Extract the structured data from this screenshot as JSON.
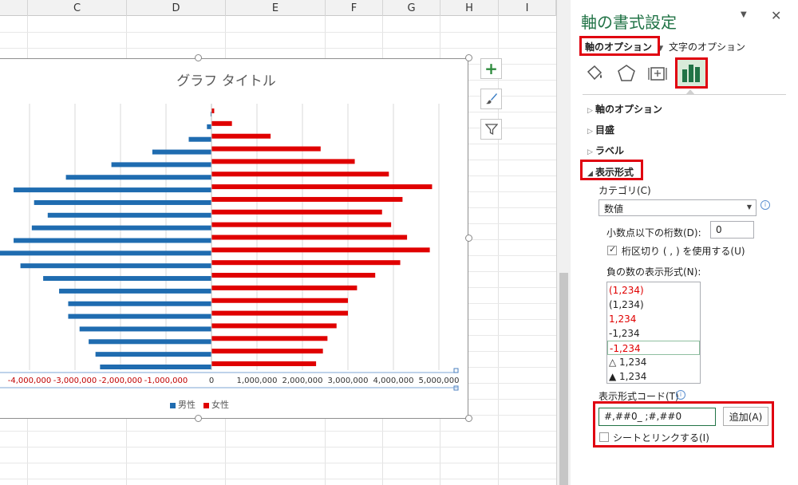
{
  "sheet": {
    "columns": [
      {
        "label": ""
      },
      {
        "label": "C"
      },
      {
        "label": "D"
      },
      {
        "label": "E"
      },
      {
        "label": "F"
      },
      {
        "label": "G"
      },
      {
        "label": "H"
      },
      {
        "label": "I"
      }
    ]
  },
  "chart": {
    "title": "グラフ タイトル",
    "legend": [
      "男性",
      "女性"
    ]
  },
  "chart_data": {
    "type": "bar",
    "orientation": "horizontal",
    "title": "グラフ タイトル",
    "xlim": [
      -5000000,
      5000000
    ],
    "x_ticks": [
      "0",
      "-4,000,000",
      "-3,000,000",
      "-2,000,000",
      "-1,000,000",
      "0",
      "1,000,000",
      "2,000,000",
      "3,000,000",
      "4,000,000",
      "5,000,000"
    ],
    "series": [
      {
        "name": "男性",
        "color": "#1f6cb0",
        "values": [
          -20000,
          -100000,
          -500000,
          -1300000,
          -2200000,
          -3200000,
          -4350000,
          -3900000,
          -3600000,
          -3950000,
          -4350000,
          -4700000,
          -4200000,
          -3700000,
          -3350000,
          -3150000,
          -3150000,
          -2900000,
          -2700000,
          -2550000,
          -2450000
        ]
      },
      {
        "name": "女性",
        "color": "#e00000",
        "values": [
          60000,
          450000,
          1300000,
          2400000,
          3150000,
          3900000,
          4850000,
          4200000,
          3750000,
          3950000,
          4300000,
          4800000,
          4150000,
          3600000,
          3200000,
          3000000,
          3000000,
          2750000,
          2550000,
          2450000,
          2300000
        ]
      }
    ]
  },
  "pane": {
    "title": "軸の書式設定",
    "tab_axis_options": "軸のオプション",
    "tab_text_options": "文字のオプション",
    "sections": {
      "axis_options": "軸のオプション",
      "tick_marks": "目盛",
      "labels": "ラベル",
      "number": "表示形式"
    },
    "category_label": "カテゴリ(C)",
    "category_value": "数値",
    "decimal_label": "小数点以下の桁数(D):",
    "decimal_value": "0",
    "separator_label": "桁区切り ( , ) を使用する(U)",
    "negative_label": "負の数の表示形式(N):",
    "negative_options": [
      {
        "text": "(1,234)",
        "color": "#e00000"
      },
      {
        "text": "(1,234)",
        "color": "#222222"
      },
      {
        "text": "1,234",
        "color": "#e00000"
      },
      {
        "text": "-1,234",
        "color": "#222222"
      },
      {
        "text": "-1,234",
        "color": "#e00000"
      },
      {
        "text": "△ 1,234",
        "color": "#222222"
      },
      {
        "text": "▲ 1,234",
        "color": "#222222"
      }
    ],
    "format_code_label": "表示形式コード(T)",
    "format_code_value": "#,##0_ ;#,##0",
    "add_button": "追加(A)",
    "link_label": "シートとリンクする(I)"
  }
}
